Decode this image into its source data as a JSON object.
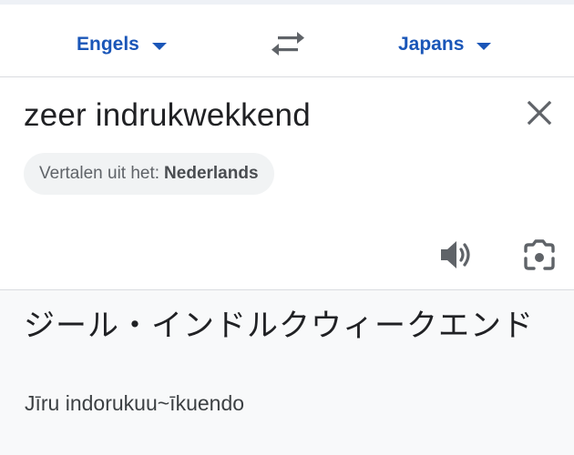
{
  "lang_bar": {
    "source_language": "Engels",
    "target_language": "Japans",
    "swap_icon": "swap-arrows-icon"
  },
  "input": {
    "text": "zeer indrukwekkend",
    "detect_prefix": "Vertalen uit het:",
    "detected_language": "Nederlands",
    "clear_icon": "close-icon",
    "speaker_icon": "speaker-icon",
    "camera_icon": "lens-camera-icon"
  },
  "output": {
    "translation": "ジール・インドルクウィークエンド",
    "transliteration": "Jīru indorukuu~īkuendo"
  },
  "colors": {
    "accent": "#1a56b8",
    "output_bg": "#f8f9fa",
    "chip_bg": "#f1f3f4",
    "icon_gray": "#5f6368"
  }
}
